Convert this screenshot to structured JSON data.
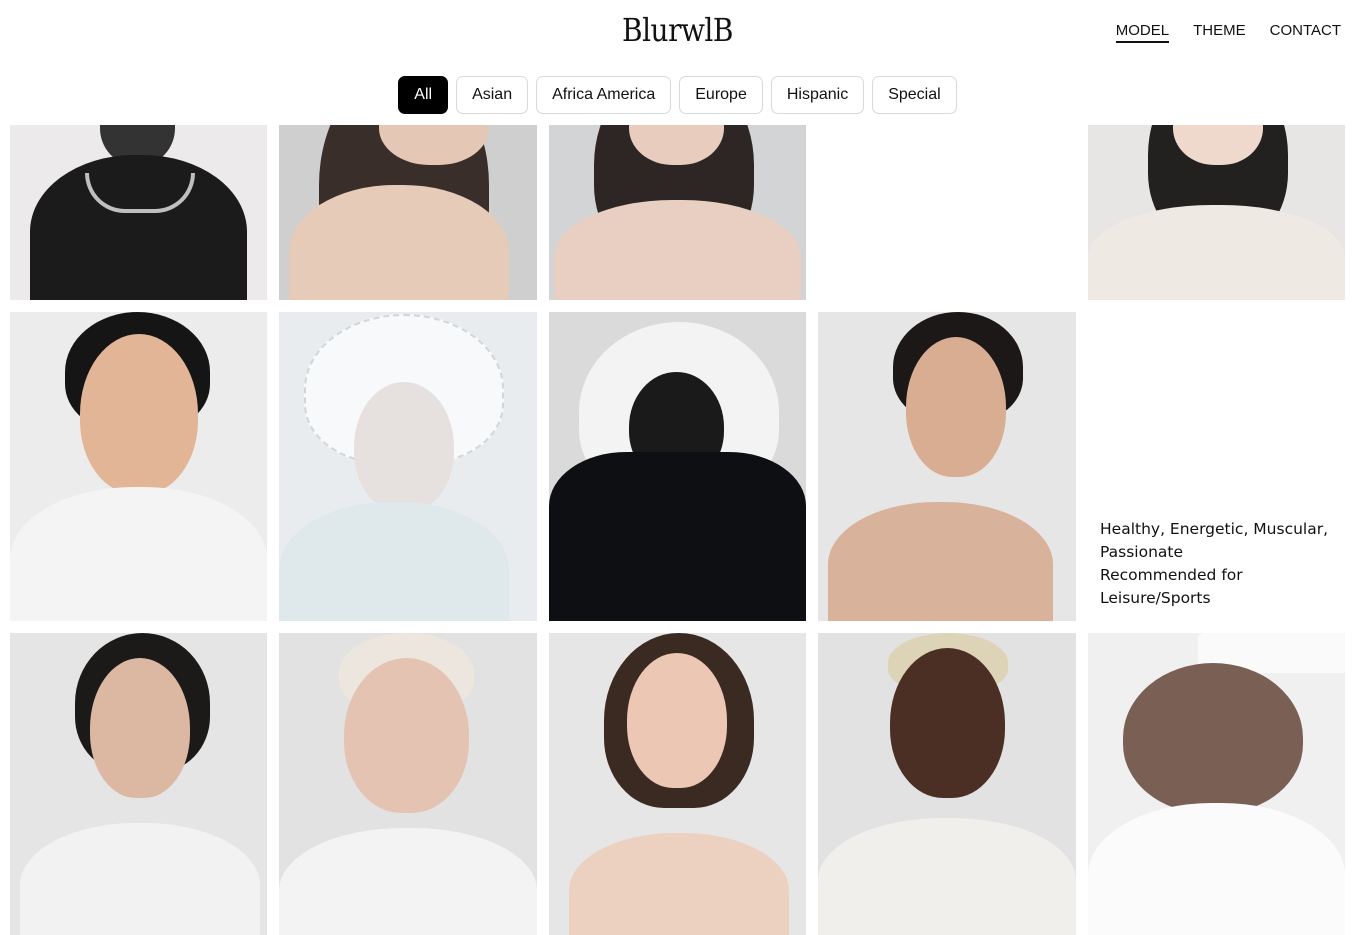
{
  "brand": {
    "logo": "BlurwlB"
  },
  "nav": [
    {
      "label": "MODEL",
      "active": true
    },
    {
      "label": "THEME",
      "active": false
    },
    {
      "label": "CONTACT",
      "active": false
    }
  ],
  "filters": [
    {
      "label": "All",
      "active": true
    },
    {
      "label": "Asian",
      "active": false
    },
    {
      "label": "Africa America",
      "active": false
    },
    {
      "label": "Europe",
      "active": false
    },
    {
      "label": "Hispanic",
      "active": false
    },
    {
      "label": "Special",
      "active": false
    }
  ],
  "grid": {
    "featured_description": {
      "line1": "Healthy, Energetic, Muscular,",
      "line2": "Passionate",
      "line3": "Recommended for",
      "line4": "Leisure/Sports"
    }
  },
  "colors": {
    "accent": "#000000",
    "chip_border": "#d9d9d9",
    "photo_background": "#ebebeb"
  }
}
